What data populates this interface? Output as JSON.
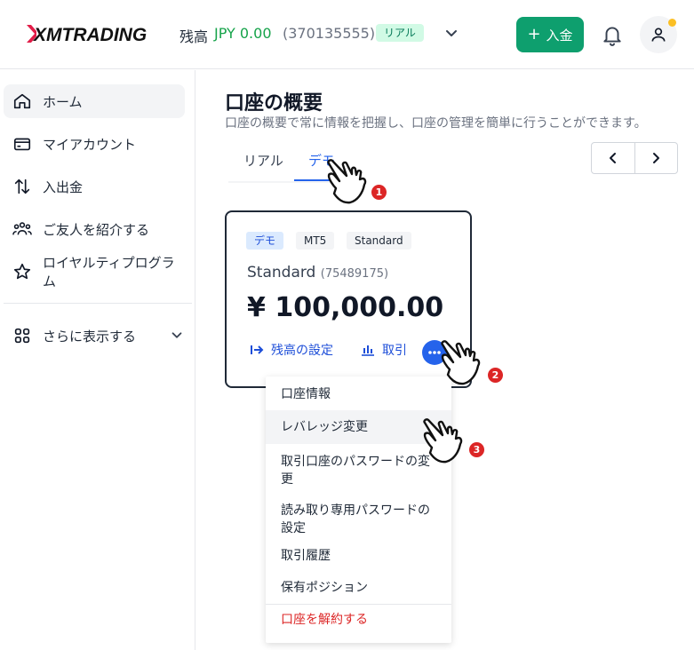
{
  "header": {
    "logo_text": "XMTRADING",
    "balance_label": "残高",
    "balance_value": "JPY 0.00",
    "account_number": "(370135555)",
    "account_type_badge": "リアル",
    "deposit_label": "入金"
  },
  "sidebar": {
    "items": [
      {
        "label": "ホーム",
        "icon": "home-icon"
      },
      {
        "label": "マイアカウント",
        "icon": "card-icon"
      },
      {
        "label": "入出金",
        "icon": "transfer-icon"
      },
      {
        "label": "ご友人を紹介する",
        "icon": "people-icon"
      },
      {
        "label": "ロイヤルティプログラム",
        "icon": "star-icon"
      }
    ],
    "more_label": "さらに表示する"
  },
  "main": {
    "title": "口座の概要",
    "description": "口座の概要で常に情報を把握し、口座の管理を簡単に行うことができます。",
    "tabs": [
      "リアル",
      "デモ"
    ],
    "active_tab": "デモ"
  },
  "card": {
    "chips": [
      "デモ",
      "MT5",
      "Standard"
    ],
    "account_name": "Standard",
    "account_id": "(75489175)",
    "balance": "¥ 100,000.00",
    "balance_setting_label": "残高の設定",
    "trade_label": "取引"
  },
  "menu": {
    "items": [
      "口座情報",
      "レバレッジ変更",
      "取引口座のパスワードの変更",
      "読み取り専用パスワードの設定",
      "取引履歴",
      "保有ポジション"
    ],
    "danger_item": "口座を解約する"
  },
  "annotations": {
    "steps": [
      "1",
      "2",
      "3"
    ]
  },
  "colors": {
    "brand_green": "#0e9f6e",
    "accent_blue": "#2563eb",
    "danger_red": "#dc2626"
  }
}
